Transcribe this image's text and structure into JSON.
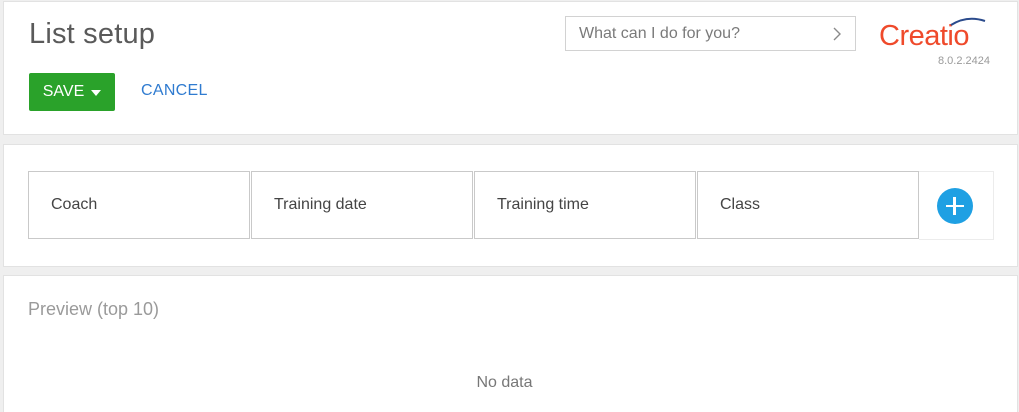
{
  "header": {
    "title": "List setup",
    "save_label": "SAVE",
    "cancel_label": "CANCEL",
    "search_placeholder": "What can I do for you?",
    "logo_text": "Creatio",
    "version": "8.0.2.2424"
  },
  "columns": [
    {
      "label": "Coach"
    },
    {
      "label": "Training date"
    },
    {
      "label": "Training time"
    },
    {
      "label": "Class"
    }
  ],
  "preview": {
    "title": "Preview (top 10)",
    "empty_text": "No data"
  },
  "colors": {
    "save": "#2aa22a",
    "cancel_link": "#2f7bd0",
    "add_button": "#1fa0e3",
    "brand": "#ef4a2b"
  },
  "icons": {
    "save_dropdown": "caret-down-icon",
    "search_go": "chevron-right-icon",
    "add_column": "plus-circle-icon"
  }
}
